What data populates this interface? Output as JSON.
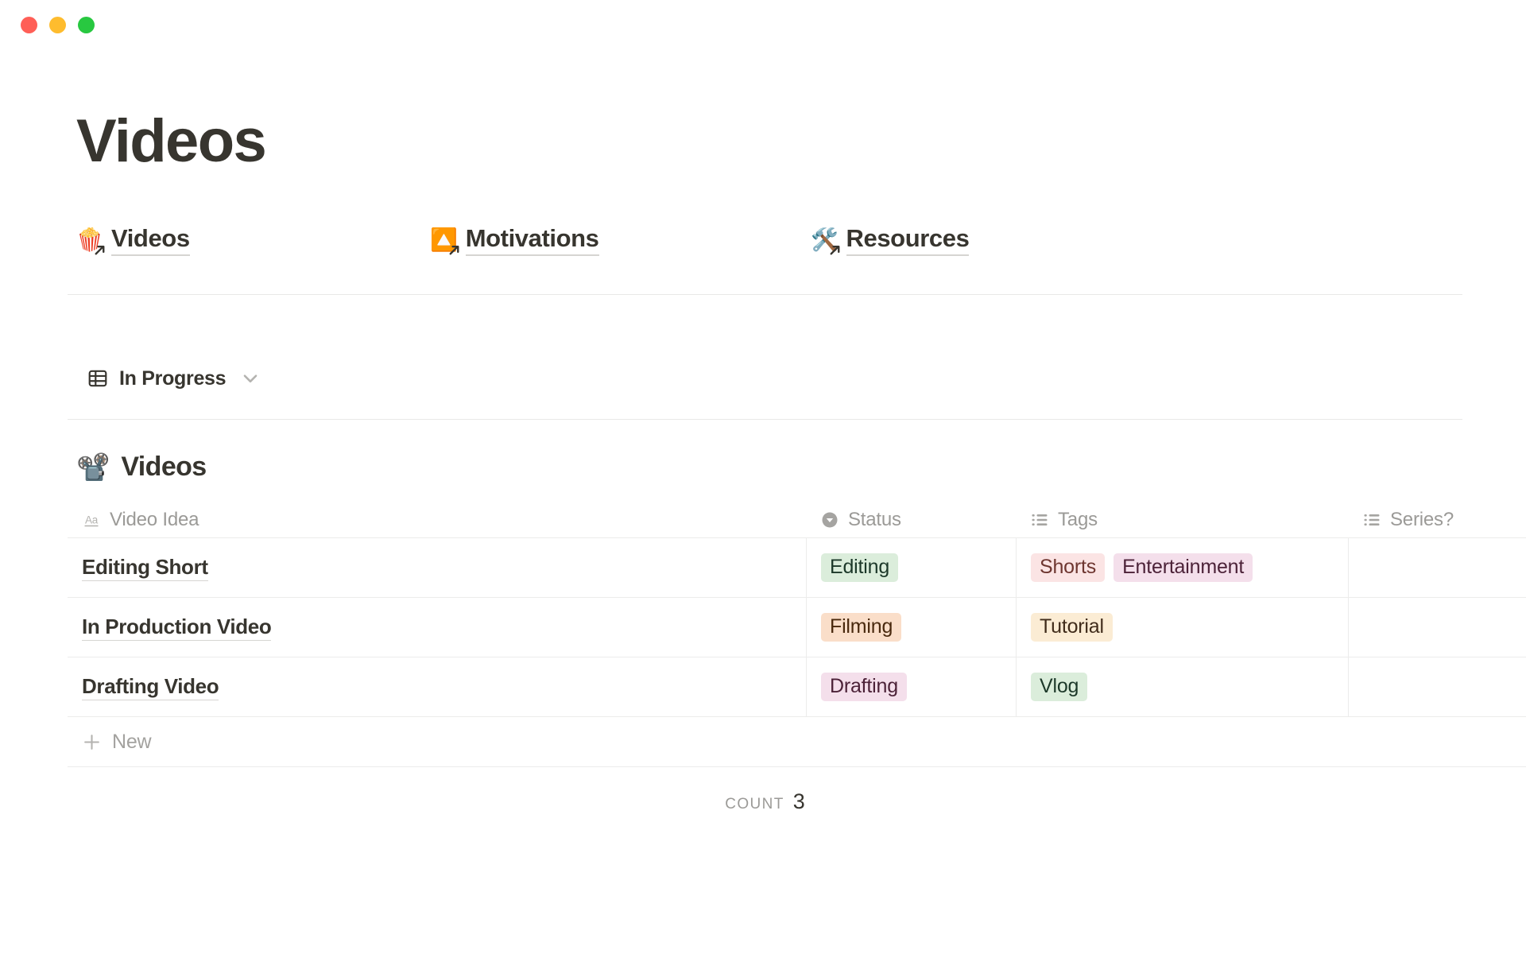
{
  "window": {
    "buttons": [
      {
        "name": "close",
        "color": "#ff5f57"
      },
      {
        "name": "minimize",
        "color": "#febc2e"
      },
      {
        "name": "maximize",
        "color": "#28c840"
      }
    ]
  },
  "page": {
    "title": "Videos"
  },
  "nav_links": [
    {
      "emoji": "🍿",
      "emoji_name": "popcorn-emoji",
      "label": "Videos"
    },
    {
      "emoji": "🔼",
      "emoji_name": "upward-triangle-emoji",
      "label": "Motivations"
    },
    {
      "emoji": "🛠️",
      "emoji_name": "hammer-and-wrench-emoji",
      "label": "Resources"
    }
  ],
  "view": {
    "icon": "table-grid-icon",
    "name": "In Progress",
    "chevron": "chevron-down-icon"
  },
  "database": {
    "emoji": "📽️",
    "emoji_name": "film-projector-emoji",
    "title": "Videos",
    "columns": [
      {
        "key": "title",
        "label": "Video Idea",
        "icon": "title-aa-icon"
      },
      {
        "key": "status",
        "label": "Status",
        "icon": "select-circle-icon"
      },
      {
        "key": "tags",
        "label": "Tags",
        "icon": "multi-select-list-icon"
      },
      {
        "key": "series",
        "label": "Series?",
        "icon": "multi-select-list-icon"
      }
    ],
    "rows": [
      {
        "title": "Editing Short",
        "status": {
          "label": "Editing",
          "bg": "#dbeddb",
          "fg": "#1c3829"
        },
        "tags": [
          {
            "label": "Shorts",
            "bg": "#fbe4e4",
            "fg": "#6e3630"
          },
          {
            "label": "Entertainment",
            "bg": "#f4dfeb",
            "fg": "#4c2238"
          }
        ],
        "series": []
      },
      {
        "title": "In Production Video",
        "status": {
          "label": "Filming",
          "bg": "#fadec9",
          "fg": "#49290e"
        },
        "tags": [
          {
            "label": "Tutorial",
            "bg": "#fbecd4",
            "fg": "#402c1b"
          }
        ],
        "series": []
      },
      {
        "title": "Drafting Video",
        "status": {
          "label": "Drafting",
          "bg": "#f4dfeb",
          "fg": "#4c2238"
        },
        "tags": [
          {
            "label": "Vlog",
            "bg": "#dbeddb",
            "fg": "#1c3829"
          }
        ],
        "series": []
      }
    ],
    "new_row_label": "New",
    "footer": {
      "count_label": "Count",
      "count_value": "3"
    }
  }
}
